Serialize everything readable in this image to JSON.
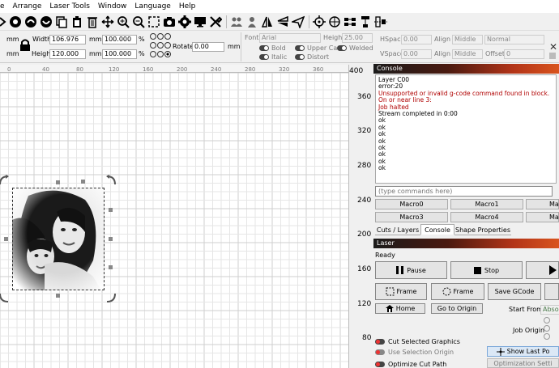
{
  "menu": {
    "items": [
      "e",
      "Arrange",
      "Laser Tools",
      "Window",
      "Language",
      "Help"
    ]
  },
  "toolbar2": {
    "unit": "mm",
    "width_label": "Width",
    "width_value": "106.976",
    "height_label": "Height",
    "height_value": "120.000",
    "scale_x": "100.000",
    "scale_y": "100.000",
    "pct": "%",
    "rotate_label": "Rotate",
    "rotate_value": "0.00",
    "font_label": "Font",
    "font_value": "Arial",
    "text_height_label": "Height",
    "text_height_value": "25.00",
    "bold": "Bold",
    "italic": "Italic",
    "upper_case": "Upper Case",
    "distort": "Distort",
    "welded": "Welded",
    "hspace_label": "HSpace",
    "hspace_value": "0.00",
    "vspace_label": "VSpace",
    "vspace_value": "0.00",
    "alignx_label": "Align X",
    "alignx_value": "Middle",
    "aligny_label": "Align Y",
    "aligny_value": "Middle",
    "normal_value": "Normal",
    "offset_label": "Offset",
    "offset_value": "0"
  },
  "ruler": {
    "top": [
      "0",
      "40",
      "80",
      "120",
      "160",
      "200",
      "240",
      "280",
      "320",
      "360",
      "400"
    ],
    "left": [
      "360",
      "320",
      "280",
      "240",
      "200",
      "160",
      "120",
      "80"
    ],
    "corner": "400"
  },
  "console": {
    "title": "Console",
    "log": [
      {
        "text": "Layer C00",
        "err": false
      },
      {
        "text": "error:20",
        "err": false
      },
      {
        "text": "Unsupported or invalid g-code command found in block.",
        "err": true
      },
      {
        "text": "On or near line 3:",
        "err": true
      },
      {
        "text": "Job halted",
        "err": true
      },
      {
        "text": "Stream completed in 0:00",
        "err": false
      },
      {
        "text": "ok",
        "err": false
      },
      {
        "text": "ok",
        "err": false
      },
      {
        "text": "ok",
        "err": false
      },
      {
        "text": "ok",
        "err": false
      },
      {
        "text": "ok",
        "err": false
      },
      {
        "text": "ok",
        "err": false
      },
      {
        "text": "ok",
        "err": false
      },
      {
        "text": "ok",
        "err": false
      }
    ],
    "command_placeholder": "(type commands here)",
    "macros": [
      "Macro0",
      "Macro1",
      "Ma",
      "Macro3",
      "Macro4",
      "Ma"
    ]
  },
  "tabs": [
    "Cuts / Layers",
    "Console",
    "Shape Properties"
  ],
  "laser": {
    "title": "Laser",
    "status": "Ready",
    "pause": "Pause",
    "stop": "Stop",
    "frame1": "Frame",
    "frame2": "Frame",
    "save_gcode": "Save GCode",
    "home": "Home",
    "go_to_origin": "Go to Origin",
    "start_from_label": "Start From:",
    "start_from_value": "Absolu",
    "job_origin_label": "Job Origin",
    "cut_selected": "Cut Selected Graphics",
    "use_selection_origin": "Use Selection Origin",
    "optimize_cut_path": "Optimize Cut Path",
    "show_last_position": "Show Last Po",
    "optimization_settings": "Optimization Setti"
  },
  "colors": {
    "accent_red": "#b23418",
    "error_text": "#b00000",
    "selection_dash": "#333333"
  }
}
